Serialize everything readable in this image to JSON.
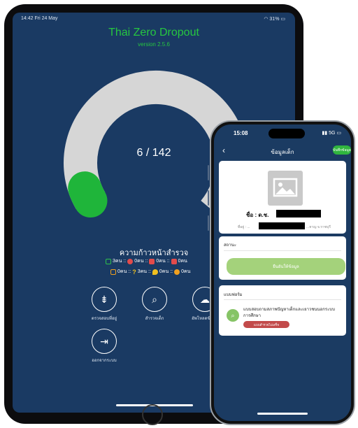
{
  "tablet": {
    "status_time": "14:42  Fri 24 May",
    "status_right": "31%",
    "app_title": "Thai Zero Dropout",
    "version": "version 2.5.6",
    "progress_count": "6 / 142",
    "progress_fraction": 0.042,
    "section_title": "ความก้าวหน้าสำรวจ",
    "stats_row1": [
      {
        "icon": "check-square-icon",
        "color": "#2ec24a",
        "text": "3คน ::"
      },
      {
        "icon": "eye-icon",
        "color": "#e24b4b",
        "text": "0คน ::"
      },
      {
        "icon": "lock-icon",
        "color": "#e24b4b",
        "text": "0คน ::"
      },
      {
        "icon": "home-icon",
        "color": "#e24b4b",
        "text": "0คน"
      }
    ],
    "stats_row2": [
      {
        "icon": "exit-icon",
        "color": "#f0a020",
        "text": "0คน ::"
      },
      {
        "icon": "question-icon",
        "color": "#f0c020",
        "text": "3คน ::"
      },
      {
        "icon": "pin-icon",
        "color": "#f0c020",
        "text": "0คน ::"
      },
      {
        "icon": "dots-icon",
        "color": "#f0a020",
        "text": "0คน"
      }
    ],
    "buttons": [
      {
        "icon": "signpost-icon",
        "label": "ตรวจสอบที่อยู่"
      },
      {
        "icon": "search-icon",
        "label": "สำรวจเด็ก"
      },
      {
        "icon": "cloud-upload-icon",
        "label": "อัพโหลดข้อมูล"
      },
      {
        "icon": "logout-icon",
        "label": "ออกจากระบบ"
      }
    ]
  },
  "phone": {
    "status_time": "15:08",
    "status_right": "5G",
    "title": "ข้อมูลเด็ก",
    "save_label": "บันทึกข้อมูล",
    "name_label": "ชื่อ : ด.ช.",
    "address_label": "ที่อยู่ : ...",
    "address_tail": "...หาญ จ.ราชบุรี",
    "status_section": "สถานะ",
    "confirm_button": "ยืนยันให้ข้อมูล",
    "form_section": "แบบฟอร์ม",
    "form_title": "แบบสอบถามสภาพปัญหาเด็กและเยาวชนนอกระบบการศึกษา",
    "form_badge": "แบบสำรวจไม่เสร็จ"
  },
  "colors": {
    "background": "#1a3a63",
    "accent_green": "#26c640",
    "gauge_track": "#d6d6d6"
  }
}
